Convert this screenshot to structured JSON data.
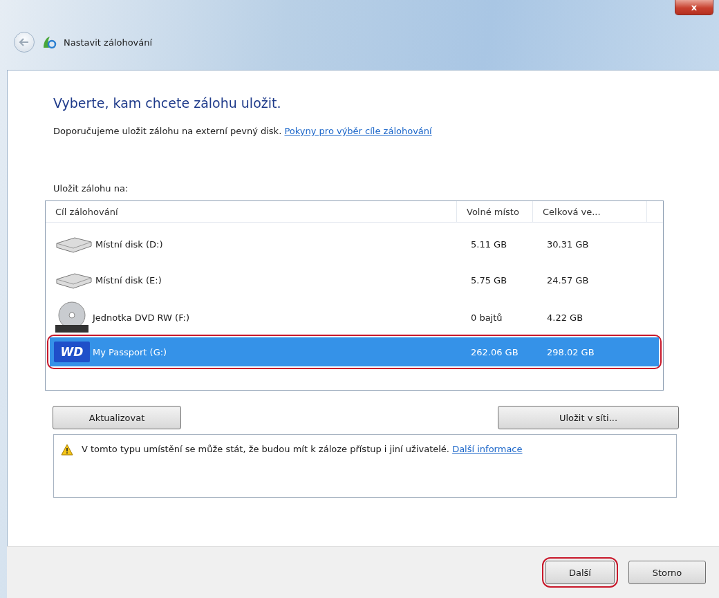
{
  "window": {
    "title": "Nastavit zálohování",
    "close_label": "x"
  },
  "heading": "Vyberte, kam chcete zálohu uložit.",
  "intro": {
    "text": "Doporučujeme uložit zálohu na externí pevný disk.",
    "link": "Pokyny pro výběr cíle zálohování"
  },
  "list_label": "Uložit zálohu na:",
  "table": {
    "columns": [
      "Cíl zálohování",
      "Volné místo",
      "Celková ve..."
    ],
    "rows": [
      {
        "kind": "hdd",
        "name": "Místní disk (D:)",
        "free": "5.11 GB",
        "total": "30.31 GB",
        "selected": false,
        "highlighted": false
      },
      {
        "kind": "hdd",
        "name": "Místní disk (E:)",
        "free": "5.75 GB",
        "total": "24.57 GB",
        "selected": false,
        "highlighted": false
      },
      {
        "kind": "dvd",
        "name": "Jednotka DVD RW (F:)",
        "free": "0 bajtů",
        "total": "4.22 GB",
        "selected": false,
        "highlighted": false
      },
      {
        "kind": "wd",
        "logo": "WD",
        "name": "My Passport (G:)",
        "free": "262.06 GB",
        "total": "298.02 GB",
        "selected": true,
        "highlighted": true
      }
    ]
  },
  "refresh_button": "Aktualizovat",
  "network_button": "Uložit v síti...",
  "warning": {
    "text": "V tomto typu umístění se může stát, že budou mít k záloze přístup i jiní uživatelé.",
    "link": "Další informace"
  },
  "footer_buttons": [
    {
      "label": "Další",
      "highlighted": true
    },
    {
      "label": "Storno",
      "highlighted": false
    }
  ]
}
